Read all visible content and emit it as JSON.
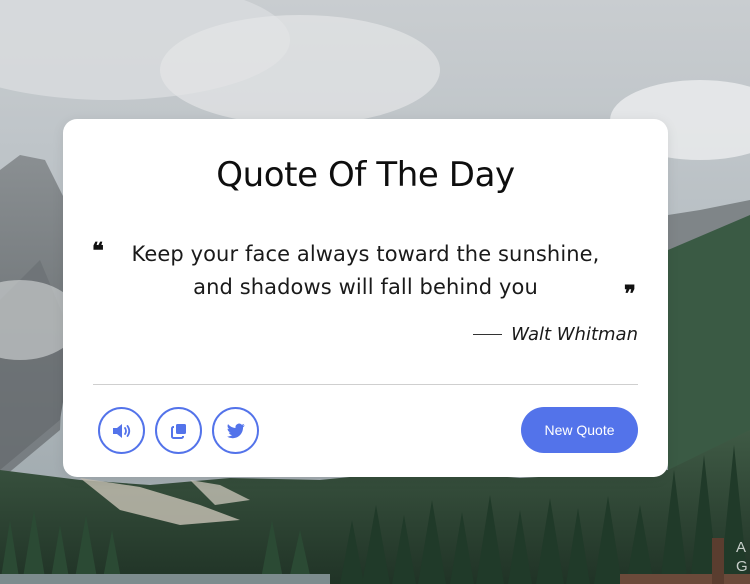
{
  "page": {
    "title": "Quote Of The Day"
  },
  "quote": {
    "text": "Keep your face always toward the sunshine, and shadows will fall behind you",
    "open_mark": "❝",
    "close_mark": "❞",
    "author": "Walt Whitman"
  },
  "actions": {
    "speak_icon": "volume-icon",
    "copy_icon": "copy-icon",
    "twitter_icon": "twitter-icon",
    "new_quote_label": "New Quote"
  },
  "watermark": {
    "line1": "A",
    "line2": "G"
  },
  "colors": {
    "accent": "#5373ea",
    "card": "#ffffff",
    "text": "#1a1a1a"
  }
}
